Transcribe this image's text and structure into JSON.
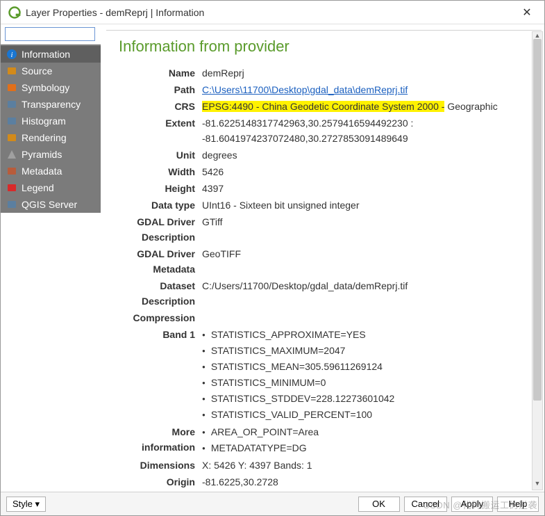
{
  "window": {
    "title": "Layer Properties - demReprj | Information",
    "close": "✕"
  },
  "search": {
    "placeholder": ""
  },
  "sidebar": {
    "items": [
      {
        "label": "Information",
        "icon": "info-icon",
        "active": true
      },
      {
        "label": "Source",
        "icon": "source-icon",
        "active": false
      },
      {
        "label": "Symbology",
        "icon": "symbology-icon",
        "active": false
      },
      {
        "label": "Transparency",
        "icon": "transparency-icon",
        "active": false
      },
      {
        "label": "Histogram",
        "icon": "histogram-icon",
        "active": false
      },
      {
        "label": "Rendering",
        "icon": "rendering-icon",
        "active": false
      },
      {
        "label": "Pyramids",
        "icon": "pyramids-icon",
        "active": false
      },
      {
        "label": "Metadata",
        "icon": "metadata-icon",
        "active": false
      },
      {
        "label": "Legend",
        "icon": "legend-icon",
        "active": false
      },
      {
        "label": "QGIS Server",
        "icon": "server-icon",
        "active": false
      }
    ]
  },
  "main": {
    "heading": "Information from provider",
    "rows": {
      "name": {
        "label": "Name",
        "value": "demReprj"
      },
      "path": {
        "label": "Path",
        "value": "C:\\Users\\11700\\Desktop\\gdal_data\\demReprj.tif"
      },
      "crs": {
        "label": "CRS",
        "value_hl": "EPSG:4490 - China Geodetic Coordinate System 2000 -",
        "value_rest": "Geographic"
      },
      "extent": {
        "label": "Extent",
        "value": "-81.6225148317742963,30.2579416594492230 : -81.6041974237072480,30.2727853091489649"
      },
      "unit": {
        "label": "Unit",
        "value": "degrees"
      },
      "width": {
        "label": "Width",
        "value": "5426"
      },
      "height": {
        "label": "Height",
        "value": "4397"
      },
      "datatype": {
        "label": "Data type",
        "value": "UInt16 - Sixteen bit unsigned integer"
      },
      "gdaldesc": {
        "label": "GDAL Driver Description",
        "value": "GTiff"
      },
      "gdalmeta": {
        "label": "GDAL Driver Metadata",
        "value": "GeoTIFF"
      },
      "dataset": {
        "label": "Dataset Description",
        "value": "C:/Users/11700/Desktop/gdal_data/demReprj.tif"
      },
      "compression": {
        "label": "Compression",
        "value": ""
      },
      "band1": {
        "label": "Band 1",
        "items": [
          "STATISTICS_APPROXIMATE=YES",
          "STATISTICS_MAXIMUM=2047",
          "STATISTICS_MEAN=305.59611269124",
          "STATISTICS_MINIMUM=0",
          "STATISTICS_STDDEV=228.12273601042",
          "STATISTICS_VALID_PERCENT=100"
        ]
      },
      "moreinfo": {
        "label": "More information",
        "items": [
          "AREA_OR_POINT=Area",
          "METADATATYPE=DG"
        ]
      },
      "dimensions": {
        "label": "Dimensions",
        "value": "X: 5426 Y: 4397 Bands: 1"
      },
      "origin": {
        "label": "Origin",
        "value": "-81.6225,30.2728"
      }
    }
  },
  "footer": {
    "style": "Style ▾",
    "ok": "OK",
    "cancel": "Cancel",
    "apply": "Apply",
    "help": "Help"
  },
  "watermark": "CSDN @代码搬运工的逆袭",
  "icons": {
    "info-icon": "#1976d2",
    "source-icon": "#d28a1a",
    "symbology-icon": "#e06f1a",
    "transparency-icon": "#5b7fa0",
    "histogram-icon": "#5b7fa0",
    "rendering-icon": "#d28a1a",
    "pyramids-icon": "#a0a0a0",
    "metadata-icon": "#b85c3b",
    "legend-icon": "#d82a2a",
    "server-icon": "#5b7fa0"
  }
}
